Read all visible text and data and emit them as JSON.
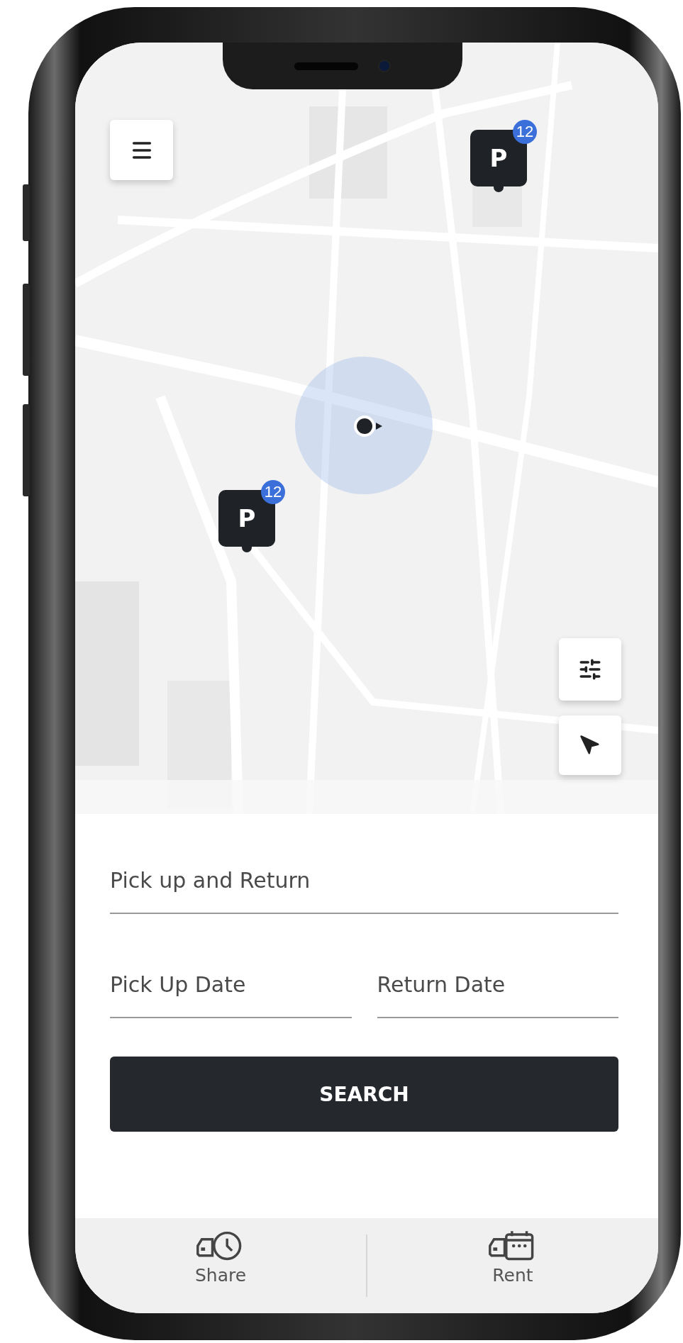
{
  "parking_markers": [
    {
      "label": "P",
      "count": "12"
    },
    {
      "label": "P",
      "count": "12"
    }
  ],
  "form": {
    "location": {
      "placeholder": "Pick up and Return"
    },
    "dates": [
      {
        "placeholder": "Pick Up Date"
      },
      {
        "placeholder": "Return Date"
      }
    ],
    "button": "SEARCH"
  },
  "bottom_nav": [
    {
      "label": "Share",
      "kind": "share"
    },
    {
      "label": "Rent",
      "kind": "rent"
    }
  ]
}
